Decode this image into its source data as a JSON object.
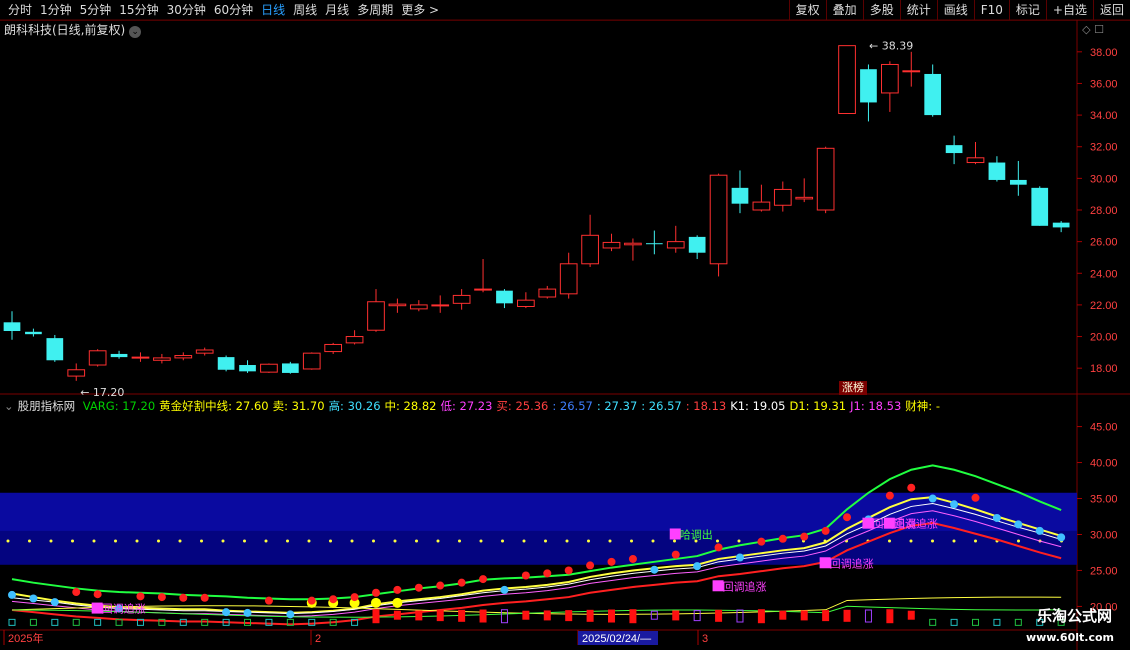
{
  "toolbar": {
    "tabs": [
      "分时",
      "1分钟",
      "5分钟",
      "15分钟",
      "30分钟",
      "60分钟",
      "日线",
      "周线",
      "月线",
      "多周期",
      "更多 >"
    ],
    "active": "日线",
    "right_buttons": [
      "复权",
      "叠加",
      "多股",
      "统计",
      "画线",
      "F10",
      "标记",
      "+自选",
      "返回"
    ]
  },
  "stock": {
    "title": "朗科科技(日线,前复权)",
    "max_label": "38.39",
    "min_label": "17.20",
    "badge": "涨榜"
  },
  "indicator": {
    "name": "股朋指标网",
    "items": [
      {
        "text": "VARG: 17.20",
        "color": "#00d000"
      },
      {
        "text": "黄金好割中线: 27.60",
        "color": "#ffff00"
      },
      {
        "text": "卖: 31.70",
        "color": "#ffff00"
      },
      {
        "text": "高: 30.26",
        "color": "#40e0ff"
      },
      {
        "text": "中: 28.82",
        "color": "#ffff00"
      },
      {
        "text": "低: 27.23",
        "color": "#ff40ff"
      },
      {
        "text": "买: 25.36",
        "color": "#ff4040"
      },
      {
        "text": ": 26.57",
        "color": "#4080ff"
      },
      {
        "text": ": 27.37",
        "color": "#40e0ff"
      },
      {
        "text": ": 26.57",
        "color": "#40e0ff"
      },
      {
        "text": ": 18.13",
        "color": "#ff4040"
      },
      {
        "text": "K1: 19.05",
        "color": "#ffffff"
      },
      {
        "text": "D1: 19.31",
        "color": "#ffff00"
      },
      {
        "text": "J1: 18.53",
        "color": "#ff40ff"
      },
      {
        "text": "财神: -",
        "color": "#ffff00"
      }
    ],
    "signals": [
      {
        "text": "回调追涨",
        "color": "#ff40ff"
      },
      {
        "text": "回调追涨",
        "color": "#ff40ff"
      },
      {
        "text": "回调追涨",
        "color": "#ff40ff"
      },
      {
        "text": "回调追涨",
        "color": "#ff40ff"
      },
      {
        "text": "回调追涨",
        "color": "#ff40ff"
      },
      {
        "text": "哈调出",
        "color": "#40ff40"
      }
    ]
  },
  "price_axis": [
    "38.00",
    "36.00",
    "34.00",
    "32.00",
    "30.00",
    "28.00",
    "26.00",
    "24.00",
    "22.00",
    "20.00",
    "18.00"
  ],
  "ind_axis": [
    "45.00",
    "40.00",
    "35.00",
    "30.00",
    "25.00",
    "20.00"
  ],
  "date_axis": {
    "labels": [
      "2025年",
      "2",
      "2025/02/24/—",
      "3"
    ]
  },
  "watermark": {
    "line1": "乐淘公式网",
    "line2": "www.60lt.com"
  },
  "colors": {
    "up": "#ff3030",
    "down": "#40f0f0",
    "bg": "#000000",
    "grid": "#5a0000"
  },
  "chart_data": {
    "type": "candlestick",
    "title": "朗科科技(日线,前复权)",
    "ylim": [
      17,
      39
    ],
    "candles": [
      {
        "o": 20.9,
        "c": 20.35,
        "h": 21.6,
        "l": 19.8
      },
      {
        "o": 20.3,
        "c": 20.15,
        "h": 20.5,
        "l": 20.0
      },
      {
        "o": 19.9,
        "c": 18.5,
        "h": 20.1,
        "l": 18.4
      },
      {
        "o": 17.5,
        "c": 17.9,
        "h": 18.3,
        "l": 17.2
      },
      {
        "o": 18.2,
        "c": 19.1,
        "h": 19.2,
        "l": 18.1
      },
      {
        "o": 18.9,
        "c": 18.7,
        "h": 19.1,
        "l": 18.6
      },
      {
        "o": 18.65,
        "c": 18.7,
        "h": 19.0,
        "l": 18.4
      },
      {
        "o": 18.5,
        "c": 18.65,
        "h": 18.9,
        "l": 18.3
      },
      {
        "o": 18.65,
        "c": 18.8,
        "h": 19.0,
        "l": 18.5
      },
      {
        "o": 18.95,
        "c": 19.15,
        "h": 19.3,
        "l": 18.8
      },
      {
        "o": 18.7,
        "c": 17.9,
        "h": 18.8,
        "l": 17.8
      },
      {
        "o": 18.2,
        "c": 17.8,
        "h": 18.5,
        "l": 17.7
      },
      {
        "o": 17.75,
        "c": 18.25,
        "h": 18.3,
        "l": 17.7
      },
      {
        "o": 18.3,
        "c": 17.7,
        "h": 18.4,
        "l": 17.65
      },
      {
        "o": 17.95,
        "c": 18.95,
        "h": 19.0,
        "l": 17.9
      },
      {
        "o": 19.05,
        "c": 19.5,
        "h": 19.6,
        "l": 18.9
      },
      {
        "o": 19.6,
        "c": 20.0,
        "h": 20.4,
        "l": 19.5
      },
      {
        "o": 20.4,
        "c": 22.2,
        "h": 23.0,
        "l": 20.3
      },
      {
        "o": 21.95,
        "c": 22.05,
        "h": 22.4,
        "l": 21.5
      },
      {
        "o": 21.75,
        "c": 22.0,
        "h": 22.3,
        "l": 21.6
      },
      {
        "o": 21.95,
        "c": 22.0,
        "h": 22.6,
        "l": 21.5
      },
      {
        "o": 22.1,
        "c": 22.6,
        "h": 23.0,
        "l": 21.7
      },
      {
        "o": 23.0,
        "c": 23.0,
        "h": 24.9,
        "l": 22.8
      },
      {
        "o": 22.9,
        "c": 22.1,
        "h": 23.0,
        "l": 21.8
      },
      {
        "o": 21.9,
        "c": 22.3,
        "h": 22.8,
        "l": 21.8
      },
      {
        "o": 22.5,
        "c": 23.0,
        "h": 23.2,
        "l": 22.4
      },
      {
        "o": 22.7,
        "c": 24.6,
        "h": 25.3,
        "l": 22.4
      },
      {
        "o": 24.6,
        "c": 26.4,
        "h": 27.7,
        "l": 24.4
      },
      {
        "o": 25.6,
        "c": 25.95,
        "h": 26.5,
        "l": 25.4
      },
      {
        "o": 25.8,
        "c": 25.9,
        "h": 26.2,
        "l": 24.8
      },
      {
        "o": 25.9,
        "c": 25.85,
        "h": 26.7,
        "l": 25.2
      },
      {
        "o": 25.6,
        "c": 26.0,
        "h": 27.0,
        "l": 25.3
      },
      {
        "o": 26.3,
        "c": 25.3,
        "h": 26.4,
        "l": 24.9
      },
      {
        "o": 24.6,
        "c": 30.2,
        "h": 30.3,
        "l": 23.8
      },
      {
        "o": 29.4,
        "c": 28.4,
        "h": 30.5,
        "l": 27.8
      },
      {
        "o": 28.0,
        "c": 28.5,
        "h": 29.6,
        "l": 27.9
      },
      {
        "o": 28.3,
        "c": 29.3,
        "h": 29.8,
        "l": 27.9
      },
      {
        "o": 28.7,
        "c": 28.8,
        "h": 30.0,
        "l": 28.5
      },
      {
        "o": 28.0,
        "c": 31.9,
        "h": 32.0,
        "l": 27.8
      },
      {
        "o": 34.1,
        "c": 38.39,
        "h": 38.39,
        "l": 34.1
      },
      {
        "o": 36.9,
        "c": 34.8,
        "h": 37.2,
        "l": 33.6
      },
      {
        "o": 35.4,
        "c": 37.2,
        "h": 37.4,
        "l": 34.2
      },
      {
        "o": 36.8,
        "c": 36.8,
        "h": 38.0,
        "l": 35.8
      },
      {
        "o": 36.6,
        "c": 34.0,
        "h": 37.2,
        "l": 33.9
      },
      {
        "o": 32.1,
        "c": 31.6,
        "h": 32.7,
        "l": 30.9
      },
      {
        "o": 31.0,
        "c": 31.3,
        "h": 32.3,
        "l": 30.9
      },
      {
        "o": 31.0,
        "c": 29.9,
        "h": 31.4,
        "l": 29.8
      },
      {
        "o": 29.9,
        "c": 29.6,
        "h": 31.1,
        "l": 28.9
      },
      {
        "o": 29.4,
        "c": 27.0,
        "h": 29.5,
        "l": 27.0
      },
      {
        "o": 27.2,
        "c": 26.9,
        "h": 27.3,
        "l": 26.6
      }
    ],
    "indicator_ylim": [
      17,
      48
    ],
    "lines": {
      "green": [
        23.8,
        23.3,
        22.9,
        22.5,
        22.2,
        22.0,
        21.9,
        21.8,
        21.6,
        21.5,
        21.4,
        21.2,
        21.1,
        21.0,
        21.0,
        21.1,
        21.3,
        21.7,
        22.1,
        22.5,
        22.8,
        23.2,
        23.7,
        23.9,
        24.0,
        24.2,
        24.4,
        24.9,
        25.4,
        25.8,
        26.2,
        26.6,
        27.0,
        27.9,
        28.5,
        29.0,
        29.5,
        29.9,
        30.8,
        33.5,
        35.8,
        37.7,
        39.0,
        39.6,
        39.0,
        38.1,
        37.0,
        35.9,
        34.6,
        33.4
      ],
      "yellow": [
        21.8,
        21.3,
        20.8,
        20.4,
        20.1,
        19.9,
        19.8,
        19.7,
        19.6,
        19.6,
        19.4,
        19.3,
        19.2,
        19.1,
        19.2,
        19.4,
        19.7,
        20.3,
        20.7,
        21.0,
        21.3,
        21.7,
        22.2,
        22.5,
        22.7,
        23.0,
        23.4,
        24.1,
        24.6,
        25.0,
        25.3,
        25.6,
        25.8,
        26.6,
        27.0,
        27.4,
        27.8,
        28.1,
        28.9,
        30.8,
        32.3,
        33.8,
        34.9,
        35.2,
        34.4,
        33.5,
        32.5,
        31.6,
        30.7,
        29.8
      ],
      "white": [
        21.2,
        20.9,
        20.6,
        20.2,
        19.9,
        19.7,
        19.6,
        19.5,
        19.4,
        19.4,
        19.3,
        19.2,
        19.1,
        19.0,
        19.1,
        19.3,
        19.6,
        20.1,
        20.5,
        20.8,
        21.1,
        21.5,
        21.9,
        22.2,
        22.4,
        22.7,
        23.1,
        23.7,
        24.2,
        24.6,
        24.9,
        25.2,
        25.4,
        26.2,
        26.6,
        27.0,
        27.4,
        27.7,
        28.4,
        30.1,
        31.4,
        32.8,
        33.9,
        34.3,
        33.6,
        32.8,
        31.9,
        31.0,
        30.2,
        29.3
      ],
      "magenta": [
        20.7,
        20.4,
        20.1,
        19.8,
        19.5,
        19.3,
        19.2,
        19.1,
        19.0,
        19.0,
        18.9,
        18.8,
        18.7,
        18.6,
        18.7,
        18.9,
        19.2,
        19.7,
        20.1,
        20.4,
        20.7,
        21.0,
        21.4,
        21.7,
        21.9,
        22.2,
        22.6,
        23.2,
        23.6,
        24.0,
        24.3,
        24.6,
        24.8,
        25.5,
        25.9,
        26.3,
        26.7,
        27.0,
        27.7,
        29.3,
        30.5,
        31.8,
        32.9,
        33.3,
        32.6,
        31.8,
        30.9,
        30.0,
        29.1,
        28.3
      ],
      "red": [
        19.5,
        19.2,
        18.9,
        18.6,
        18.4,
        18.2,
        18.1,
        18.0,
        17.9,
        17.9,
        17.8,
        17.7,
        17.6,
        17.5,
        17.6,
        17.8,
        18.1,
        18.6,
        18.9,
        19.2,
        19.5,
        19.8,
        20.2,
        20.5,
        20.7,
        21.0,
        21.3,
        21.9,
        22.3,
        22.7,
        23.0,
        23.3,
        23.5,
        24.2,
        24.5,
        24.9,
        25.3,
        25.6,
        26.2,
        27.8,
        29.0,
        30.2,
        31.2,
        31.6,
        30.9,
        30.1,
        29.3,
        28.4,
        27.5,
        26.7
      ]
    },
    "histogram": [
      0,
      0,
      0,
      0,
      0,
      0,
      0,
      0,
      0,
      0,
      0,
      0,
      0,
      0,
      0,
      0,
      0,
      1,
      1,
      1,
      1,
      1,
      1,
      1,
      1,
      1,
      1,
      1,
      1,
      1,
      1,
      1,
      1,
      1,
      1,
      1,
      1,
      1,
      1,
      1,
      1,
      1,
      1,
      0,
      0,
      0,
      0,
      0,
      0,
      0
    ]
  }
}
